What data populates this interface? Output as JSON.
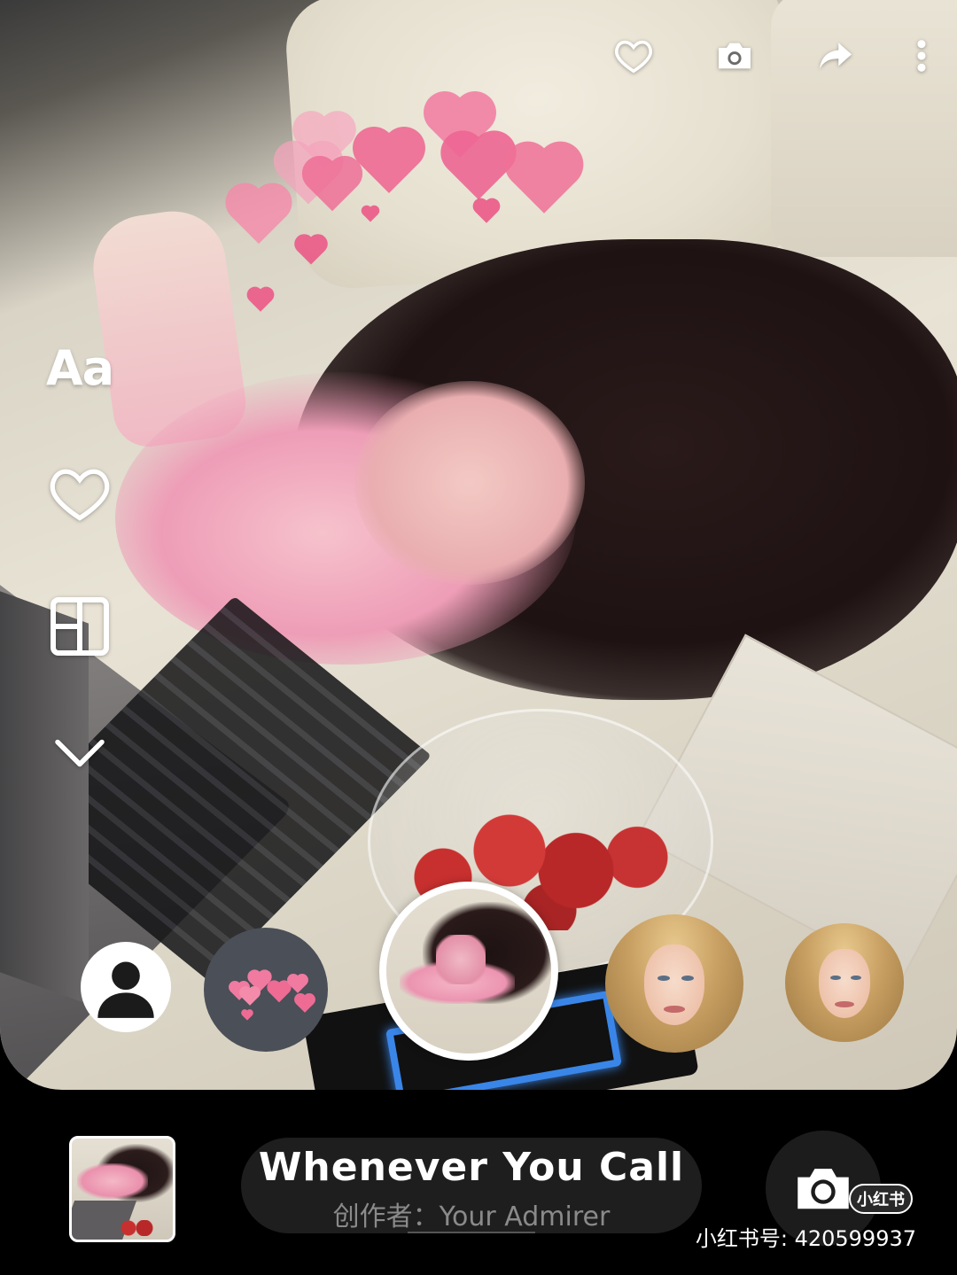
{
  "top_toolbar": {
    "favorite_icon": "heart-outline-icon",
    "snapshot_icon": "camera-icon",
    "share_icon": "share-arrow-icon",
    "more_icon": "more-vertical-icon"
  },
  "left_toolbar": {
    "text_label": "Aa",
    "like_icon": "heart-outline-icon",
    "layout_icon": "layout-grid-icon",
    "collapse_icon": "chevron-down-icon"
  },
  "effects": {
    "items": [
      {
        "name": "none",
        "icon": "person-silhouette-icon"
      },
      {
        "name": "hearts",
        "icon": "hearts-sticker-icon"
      },
      {
        "name": "selected-photo",
        "selected": true
      },
      {
        "name": "portrait-1"
      },
      {
        "name": "portrait-2"
      }
    ]
  },
  "bottom_bar": {
    "music": {
      "title": "Whenever You Call",
      "creator": "创作者：Your Admirer"
    },
    "shutter_icon": "camera-icon"
  },
  "watermark": {
    "badge": "小红书",
    "id_text": "小红书号: 420599937"
  },
  "colors": {
    "heart_pink": "#f0628f",
    "background": "#000000",
    "pill": "#1e1e1e"
  }
}
